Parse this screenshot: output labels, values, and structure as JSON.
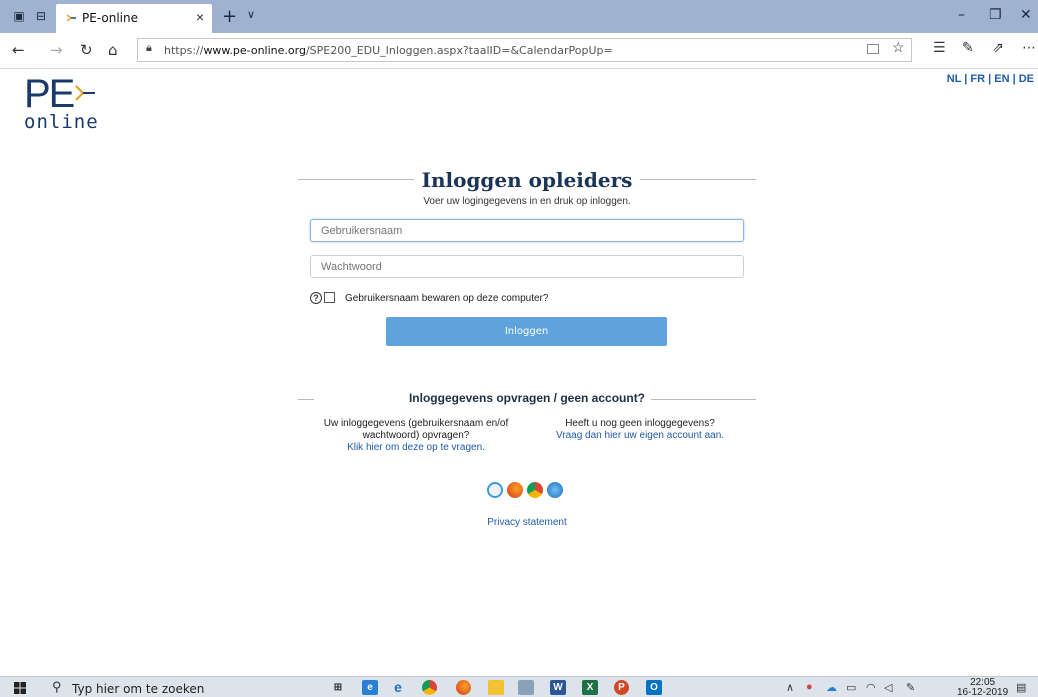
{
  "browser": {
    "tab_title": "PE-online",
    "tab_close": "×",
    "new_tab": "+",
    "tab_menu": "∨",
    "url_prefix": "https://",
    "url_domain": "www.pe-online.org",
    "url_path": "/SPE200_EDU_Inloggen.aspx?taalID=&CalendarPopUp=",
    "icons": [
      "tab-preview-icon",
      "tab-aside-icon",
      "back-icon",
      "forward-icon",
      "refresh-icon",
      "home-icon",
      "lock-icon",
      "reading-view-icon",
      "favorite-star-icon",
      "favorites-hub-icon",
      "pen-icon",
      "share-icon",
      "more-icon"
    ]
  },
  "page": {
    "logo_pe": "PE",
    "logo_online": "online",
    "languages": [
      "NL",
      "FR",
      "EN",
      "DE"
    ],
    "lang_separator": " | ",
    "heading": "Inloggen opleiders",
    "subheading": "Voer uw logingegevens in en druk op inloggen.",
    "username_placeholder": "Gebruikersnaam",
    "password_placeholder": "Wachtwoord",
    "help_symbol": "?",
    "remember_label": "Gebruikersnaam bewaren op deze computer?",
    "login_button": "Inloggen",
    "section2_title": "Inloggegevens opvragen / geen account?",
    "left_col_text_1": "Uw inloggegevens (gebruikersnaam en/of",
    "left_col_text_2": "wachtwoord) opvragen?",
    "left_col_link": "Klik hier om deze op te vragen.",
    "right_col_text": "Heeft u nog geen inloggegevens?",
    "right_col_link": "Vraag dan hier uw eigen account aan.",
    "privacy": "Privacy statement",
    "colors": {
      "brand": "#1a3a6b",
      "link": "#1f5ca8",
      "button": "#5fa3dd"
    }
  },
  "taskbar": {
    "search_text": "Typ hier om te zoeken",
    "time": "22:05",
    "date": "16-12-2019"
  }
}
